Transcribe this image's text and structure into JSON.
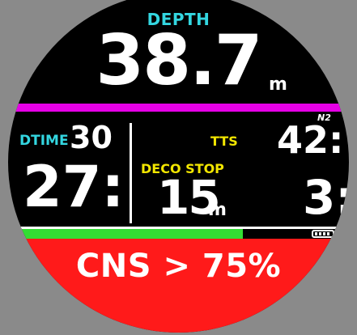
{
  "depth": {
    "label": "DEPTH",
    "value": "38.7",
    "unit": "m"
  },
  "gas": {
    "label": "N2",
    "tissue_bar_color": "#e600e6"
  },
  "dive_time": {
    "label": "DTIME",
    "value": "30"
  },
  "ndl_value": "27:",
  "tts": {
    "label": "TTS",
    "value": "42:"
  },
  "deco_stop": {
    "label": "DECO STOP",
    "depth": "15",
    "unit": "m",
    "time": "3:"
  },
  "status_bar": {
    "fill_fraction": 0.69,
    "fill_color": "#33dd33",
    "battery_icon": "battery-icon"
  },
  "warning": {
    "text": "CNS > 75%",
    "color": "#ff1a1a"
  }
}
